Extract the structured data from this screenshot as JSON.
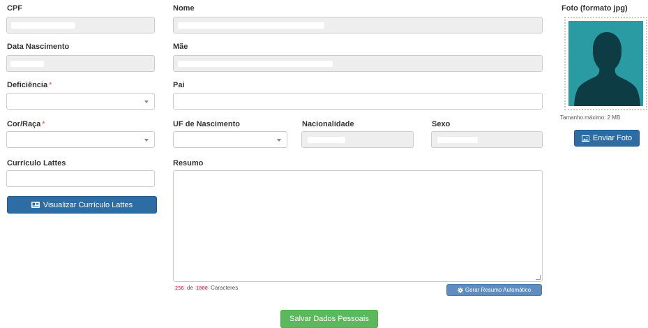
{
  "labels": {
    "cpf": "CPF",
    "nome": "Nome",
    "foto": "Foto (formato jpg)",
    "data_nascimento": "Data Nascimento",
    "mae": "Mãe",
    "deficiencia": "Deficiência",
    "pai": "Pai",
    "cor_raca": "Cor/Raça",
    "uf_nascimento": "UF de Nascimento",
    "nacionalidade": "Nacionalidade",
    "sexo": "Sexo",
    "curriculo_lattes": "Currículo Lattes",
    "resumo": "Resumo"
  },
  "required_marker": "*",
  "photo": {
    "max_size_text": "Tamanho máximo: 2 MB",
    "upload_label": "Enviar Foto"
  },
  "buttons": {
    "visualizar_lattes": "Visualizar Currículo Lattes",
    "gerar_resumo": "Gerar Resumo Automático",
    "salvar": "Salvar Dados Pessoais"
  },
  "resumo_counter": {
    "count": "256",
    "separator": "de",
    "max": "1000",
    "suffix": "Caracteres"
  },
  "colors": {
    "primary": "#2e6da4",
    "success": "#5cb85c",
    "required": "#d9534f",
    "photo_bg": "#2a9aa3"
  }
}
